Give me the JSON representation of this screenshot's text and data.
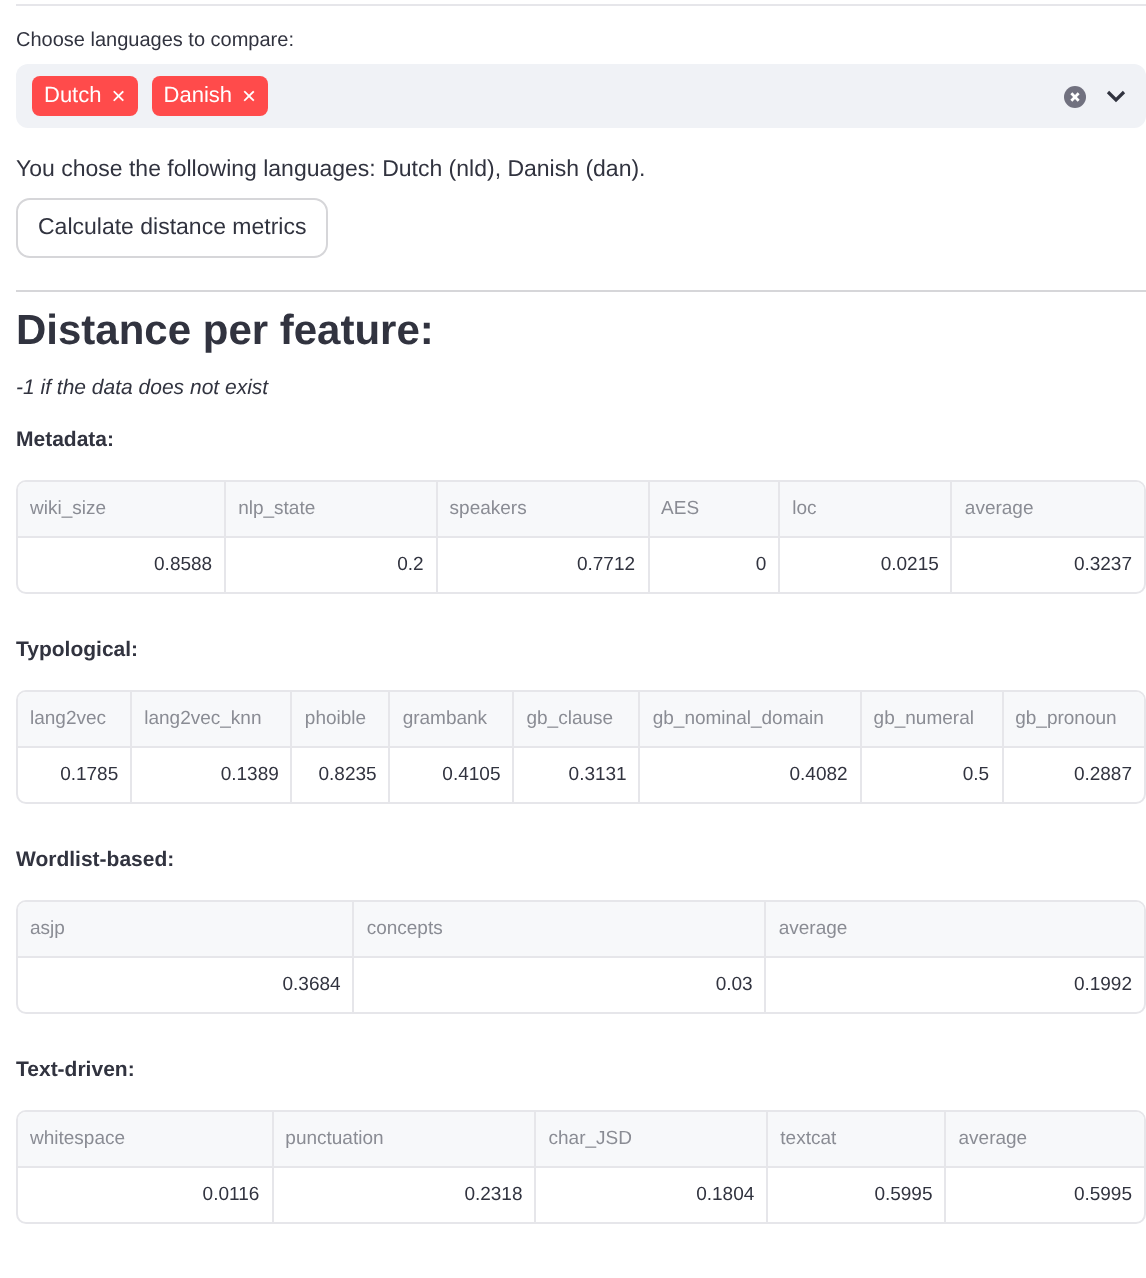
{
  "selector": {
    "label": "Choose languages to compare:",
    "chips": [
      {
        "label": "Dutch",
        "remove": "×"
      },
      {
        "label": "Danish",
        "remove": "×"
      }
    ]
  },
  "chosen_text": "You chose the following languages: Dutch (nld), Danish (dan).",
  "button": "Calculate distance metrics",
  "heading": "Distance per feature:",
  "note": "-1 if the data does not exist",
  "sections": [
    {
      "title": "Metadata:",
      "columns": [
        "wiki_size",
        "nlp_state",
        "speakers",
        "AES",
        "loc",
        "average"
      ],
      "values": [
        "0.8588",
        "0.2",
        "0.7712",
        "0",
        "0.0215",
        "0.3237"
      ]
    },
    {
      "title": "Typological:",
      "columns": [
        "lang2vec",
        "lang2vec_knn",
        "phoible",
        "grambank",
        "gb_clause",
        "gb_nominal_domain",
        "gb_numeral",
        "gb_pronoun"
      ],
      "values": [
        "0.1785",
        "0.1389",
        "0.8235",
        "0.4105",
        "0.3131",
        "0.4082",
        "0.5",
        "0.2887"
      ]
    },
    {
      "title": "Wordlist-based:",
      "columns": [
        "asjp",
        "concepts",
        "average"
      ],
      "values": [
        "0.3684",
        "0.03",
        "0.1992"
      ]
    },
    {
      "title": "Text-driven:",
      "columns": [
        "whitespace",
        "punctuation",
        "char_JSD",
        "textcat",
        "average"
      ],
      "values": [
        "0.0116",
        "0.2318",
        "0.1804",
        "0.5995",
        "0.5995"
      ]
    }
  ]
}
